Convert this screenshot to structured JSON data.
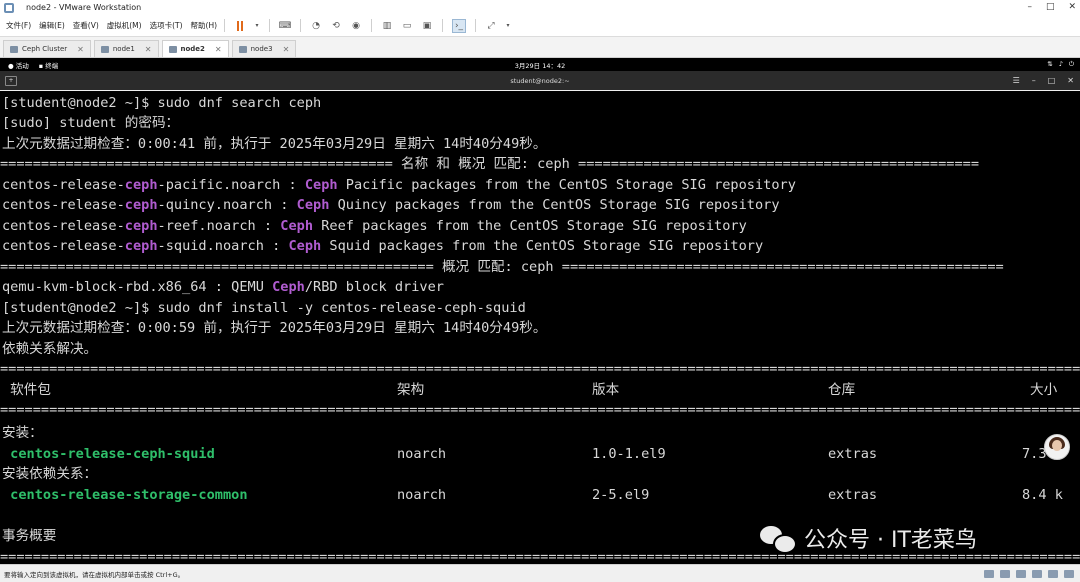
{
  "window": {
    "title": "node2 - VMware Workstation"
  },
  "menu": [
    "文件(F)",
    "编辑(E)",
    "查看(V)",
    "虚拟机(M)",
    "选项卡(T)",
    "帮助(H)"
  ],
  "tabs": [
    {
      "label": "Ceph Cluster",
      "active": false
    },
    {
      "label": "node1",
      "active": false
    },
    {
      "label": "node2",
      "active": true
    },
    {
      "label": "node3",
      "active": false
    }
  ],
  "gnome": {
    "activities": "活动",
    "app": "终端",
    "clock": "3月29日 14：42"
  },
  "terminal": {
    "title": "student@node2:~",
    "lines": {
      "l1": "[student@node2 ~]$ sudo dnf search ceph",
      "l2": "[sudo] student 的密码：",
      "l3": "上次元数据过期检查：0:00:41 前，执行于 2025年03月29日 星期六 14时40分49秒。",
      "sep_name_summary": "================================================ 名称 和 概况 匹配: ceph =================================================",
      "pkgs": [
        {
          "pre": "centos-release-",
          "hl": "ceph",
          "post": "-pacific.noarch : ",
          "hl2": "Ceph",
          "post2": " Pacific packages from the CentOS Storage SIG repository"
        },
        {
          "pre": "centos-release-",
          "hl": "ceph",
          "post": "-quincy.noarch : ",
          "hl2": "Ceph",
          "post2": " Quincy packages from the CentOS Storage SIG repository"
        },
        {
          "pre": "centos-release-",
          "hl": "ceph",
          "post": "-reef.noarch : ",
          "hl2": "Ceph",
          "post2": " Reef packages from the CentOS Storage SIG repository"
        },
        {
          "pre": "centos-release-",
          "hl": "ceph",
          "post": "-squid.noarch : ",
          "hl2": "Ceph",
          "post2": " Squid packages from the CentOS Storage SIG repository"
        }
      ],
      "sep_summary": "===================================================== 概况 匹配: ceph ======================================================",
      "qemu": {
        "pre": "qemu-kvm-block-rbd.x86_64 : QEMU ",
        "hl": "Ceph",
        "post": "/RBD block driver"
      },
      "l_install": "[student@node2 ~]$ sudo dnf install -y centos-release-ceph-squid",
      "l_meta2": "上次元数据过期检查：0:00:59 前，执行于 2025年03月29日 星期六 14时40分49秒。",
      "l_deps": "依赖关系解决。",
      "double_sep": "=======================================================================================================================================================",
      "table_header": {
        "pkg": " 软件包",
        "arch": "架构",
        "ver": "版本",
        "repo": "仓库",
        "size": "大小"
      },
      "install_label": "安装：",
      "row1": {
        "pkg": " centos-release-ceph-squid",
        "arch": "noarch",
        "ver": "1.0-1.el9",
        "repo": "extras",
        "size": "7.3 k"
      },
      "deps_label": "安装依赖关系：",
      "row2": {
        "pkg": " centos-release-storage-common",
        "arch": "noarch",
        "ver": "2-5.el9",
        "repo": "extras",
        "size": "8.4 k"
      },
      "tx_summary": "事务概要"
    }
  },
  "watermark": "公众号 · IT老菜鸟",
  "status": {
    "text": "要将输入定向到该虚拟机，请在虚拟机内部单击或按 Ctrl+G。"
  },
  "colors": {
    "highlight": "#b05cd0",
    "package_green": "#2fbf6a",
    "terminal_bg": "#000000",
    "terminal_fg": "#d8d8d8"
  }
}
